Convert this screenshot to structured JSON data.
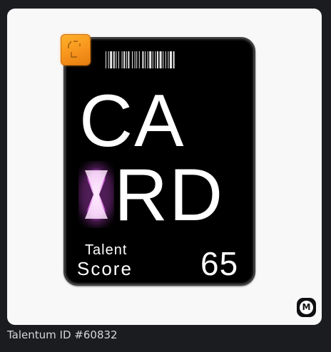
{
  "card": {
    "line1": "CA",
    "line2": "RD",
    "label_line1": "Talent",
    "label_line2": "Score",
    "score": "65"
  },
  "badge": {
    "letter": "M"
  },
  "caption": "Talentum ID #60832",
  "icons": [
    "chip-icon",
    "barcode-icon",
    "hourglass-icon",
    "marketplace-m-icon"
  ],
  "colors": {
    "chip": "#f7941d",
    "card": "#000000",
    "hourglass_glow": "#e070e8",
    "page_bg": "#1b1c20",
    "panel_bg": "#f8f8f8"
  }
}
